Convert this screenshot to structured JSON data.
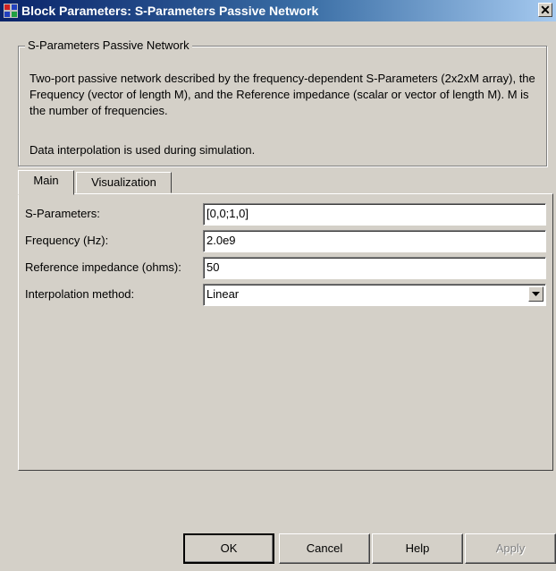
{
  "window": {
    "title": "Block Parameters: S-Parameters Passive Network",
    "close_glyph": "✕"
  },
  "block": {
    "group_title": "S-Parameters Passive Network",
    "description": "Two-port passive network described by the frequency-dependent S-Parameters (2x2xM array),  the Frequency (vector of length M), and the Reference impedance (scalar or vector of length M).  M is the number of frequencies.",
    "note": "Data interpolation is used during simulation."
  },
  "tabs": [
    {
      "label": "Main",
      "active": true
    },
    {
      "label": "Visualization",
      "active": false
    }
  ],
  "fields": {
    "s_parameters": {
      "label": "S-Parameters:",
      "value": "[0,0;1,0]"
    },
    "frequency": {
      "label": "Frequency (Hz):",
      "value": "2.0e9"
    },
    "reference_impedance": {
      "label": "Reference impedance (ohms):",
      "value": "50"
    },
    "interpolation": {
      "label": "Interpolation method:",
      "value": "Linear"
    }
  },
  "buttons": {
    "ok": "OK",
    "cancel": "Cancel",
    "help": "Help",
    "apply": "Apply"
  }
}
